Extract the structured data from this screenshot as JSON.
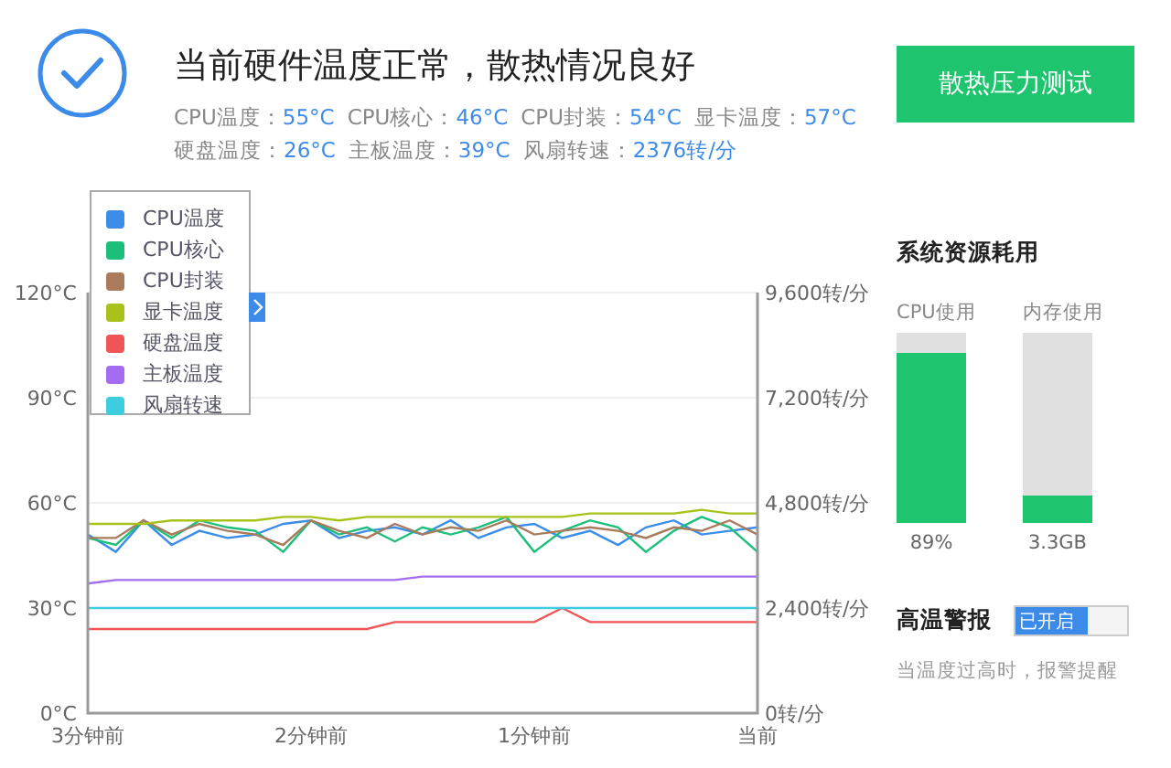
{
  "status": {
    "ok": true,
    "title": "当前硬件温度正常，散热情况良好"
  },
  "stats": [
    [
      {
        "label": "CPU温度：",
        "value": "55°C"
      },
      {
        "label": "CPU核心：",
        "value": "46°C"
      },
      {
        "label": "CPU封装：",
        "value": "54°C"
      },
      {
        "label": "显卡温度：",
        "value": "57°C"
      }
    ],
    [
      {
        "label": "硬盘温度：",
        "value": "26°C"
      },
      {
        "label": "主板温度：",
        "value": "39°C"
      },
      {
        "label": "风扇转速：",
        "value": "2376转/分"
      }
    ]
  ],
  "stress_test_button": "散热压力测试",
  "chart": {
    "legend": {
      "expanded": true
    },
    "chart_data": {
      "type": "line",
      "grid": true,
      "legend": "top-left",
      "x": [
        -3,
        -2.875,
        -2.75,
        -2.625,
        -2.5,
        -2.375,
        -2.25,
        -2.125,
        -2,
        -1.875,
        -1.75,
        -1.625,
        -1.5,
        -1.375,
        -1.25,
        -1.125,
        -1,
        -0.875,
        -0.75,
        -0.625,
        -0.5,
        -0.375,
        -0.25,
        -0.125,
        0
      ],
      "xlim": [
        -3,
        0
      ],
      "xticks": [
        {
          "value": -3,
          "label": "3分钟前"
        },
        {
          "value": -2,
          "label": "2分钟前"
        },
        {
          "value": -1,
          "label": "1分钟前"
        },
        {
          "value": 0,
          "label": "当前"
        }
      ],
      "ylim": [
        0,
        120
      ],
      "yticks": [
        {
          "value": 0,
          "label": "0°C"
        },
        {
          "value": 30,
          "label": "30°C"
        },
        {
          "value": 60,
          "label": "60°C"
        },
        {
          "value": 90,
          "label": "90°C"
        },
        {
          "value": 120,
          "label": "120°C"
        }
      ],
      "y2lim": [
        0,
        9600
      ],
      "y2ticks": [
        {
          "value": 0,
          "label": "0转/分"
        },
        {
          "value": 2400,
          "label": "2,400转/分"
        },
        {
          "value": 4800,
          "label": "4,800转/分"
        },
        {
          "value": 7200,
          "label": "7,200转/分"
        },
        {
          "value": 9600,
          "label": "9,600转/分"
        }
      ],
      "series": [
        {
          "name": "CPU温度",
          "color": "#3b8de8",
          "values": [
            51,
            46,
            55,
            48,
            52,
            50,
            51,
            54,
            55,
            50,
            52,
            53,
            51,
            55,
            50,
            53,
            54,
            50,
            52,
            48,
            53,
            55,
            51,
            52,
            53
          ]
        },
        {
          "name": "CPU核心",
          "color": "#1cbf7a",
          "values": [
            50,
            48,
            55,
            50,
            55,
            53,
            52,
            46,
            55,
            51,
            53,
            49,
            53,
            51,
            53,
            56,
            46,
            52,
            55,
            53,
            46,
            52,
            56,
            53,
            46
          ]
        },
        {
          "name": "CPU封装",
          "color": "#a97a5c",
          "values": [
            50,
            50,
            55,
            51,
            54,
            52,
            51,
            48,
            55,
            52,
            50,
            54,
            51,
            53,
            52,
            55,
            51,
            52,
            53,
            52,
            50,
            53,
            52,
            55,
            51
          ]
        },
        {
          "name": "显卡温度",
          "color": "#a8c21a",
          "values": [
            54,
            54,
            54,
            55,
            55,
            55,
            55,
            56,
            56,
            55,
            56,
            56,
            56,
            56,
            56,
            56,
            56,
            56,
            57,
            57,
            57,
            57,
            58,
            57,
            57
          ]
        },
        {
          "name": "硬盘温度",
          "color": "#f05454",
          "values": [
            24,
            24,
            24,
            24,
            24,
            24,
            24,
            24,
            24,
            24,
            24,
            26,
            26,
            26,
            26,
            26,
            26,
            30,
            26,
            26,
            26,
            26,
            26,
            26,
            26
          ]
        },
        {
          "name": "主板温度",
          "color": "#a46cf0",
          "values": [
            37,
            38,
            38,
            38,
            38,
            38,
            38,
            38,
            38,
            38,
            38,
            38,
            39,
            39,
            39,
            39,
            39,
            39,
            39,
            39,
            39,
            39,
            39,
            39,
            39
          ]
        },
        {
          "name": "风扇转速",
          "color": "#3dcce0",
          "axis": "y2",
          "values": [
            2400,
            2400,
            2400,
            2400,
            2400,
            2400,
            2400,
            2400,
            2400,
            2400,
            2400,
            2400,
            2400,
            2400,
            2400,
            2400,
            2400,
            2400,
            2400,
            2400,
            2400,
            2400,
            2400,
            2400,
            2400
          ]
        }
      ]
    }
  },
  "resources": {
    "title": "系统资源耗用",
    "meters": [
      {
        "label": "CPU使用",
        "level": 0.89,
        "reading": "89%"
      },
      {
        "label": "内存使用",
        "level": 0.14,
        "reading": "3.3GB"
      }
    ]
  },
  "alarm": {
    "label": "高温警报",
    "on": true,
    "toggle_text": "已开启",
    "hint": "当温度过高时，报警提醒"
  }
}
